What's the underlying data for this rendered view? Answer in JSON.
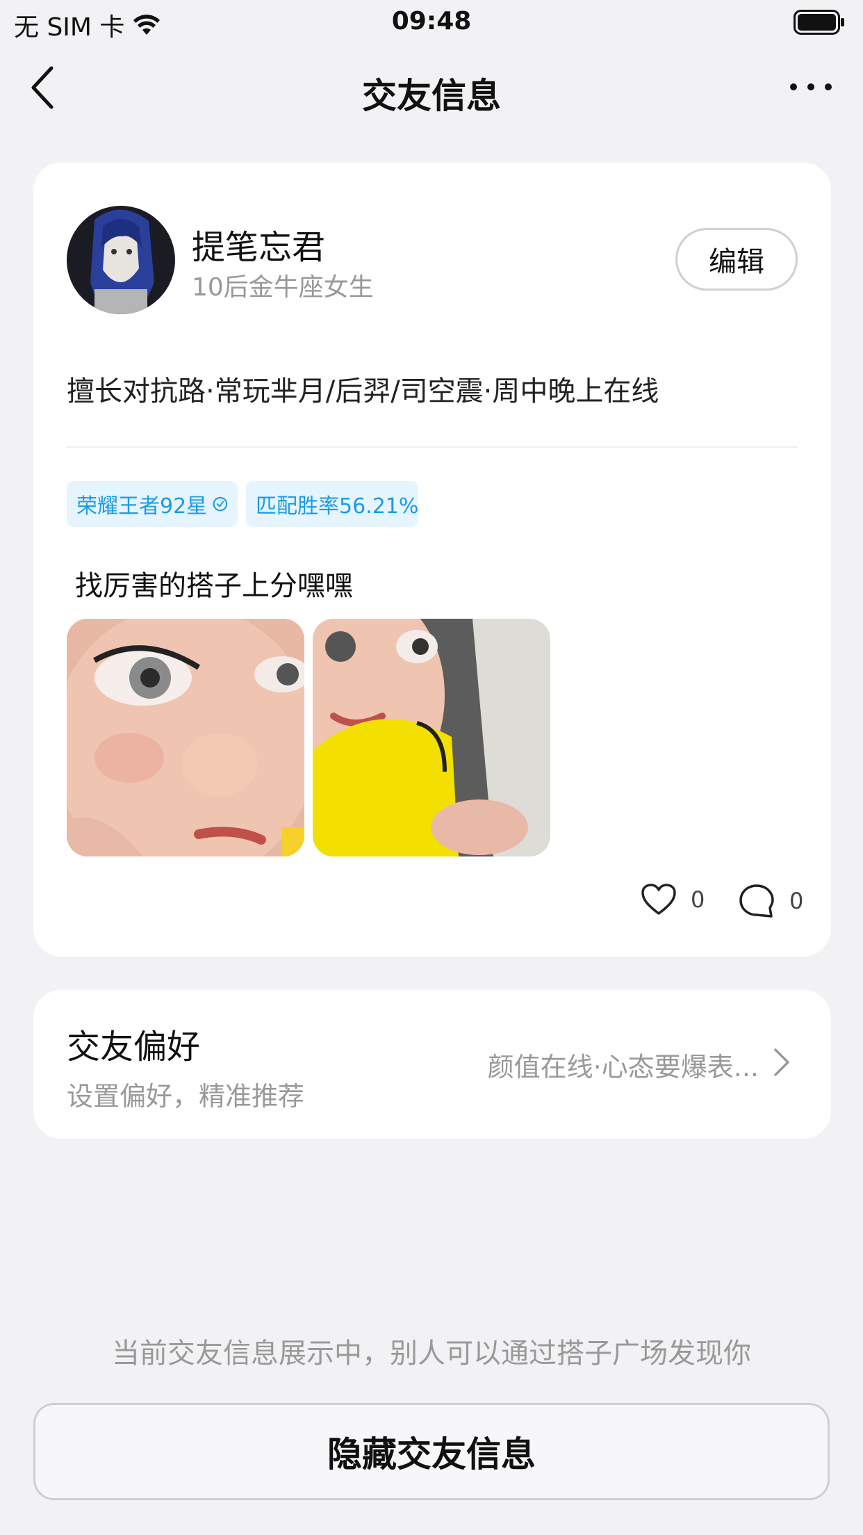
{
  "status_bar": {
    "carrier": "无 SIM 卡",
    "time": "09:48"
  },
  "nav": {
    "title": "交友信息"
  },
  "profile": {
    "name": "提笔忘君",
    "subtitle": "10后金牛座女生",
    "edit_label": "编辑",
    "description": "擅长对抗路·常玩芈月/后羿/司空震·周中晚上在线",
    "tags": [
      "荣耀王者92星",
      "匹配胜率56.21%"
    ],
    "post_text": "找厉害的搭子上分嘿嘿",
    "likes": "0",
    "comments": "0"
  },
  "preference": {
    "title": "交友偏好",
    "subtitle": "设置偏好，精准推荐",
    "value": "颜值在线·心态要爆表..."
  },
  "footer": {
    "notice": "当前交友信息展示中，别人可以通过搭子广场发现你",
    "hide_label": "隐藏交友信息"
  },
  "colors": {
    "tag_bg": "#e6f4fd",
    "tag_text": "#1a9be8",
    "page_bg": "#f2f2f5"
  }
}
